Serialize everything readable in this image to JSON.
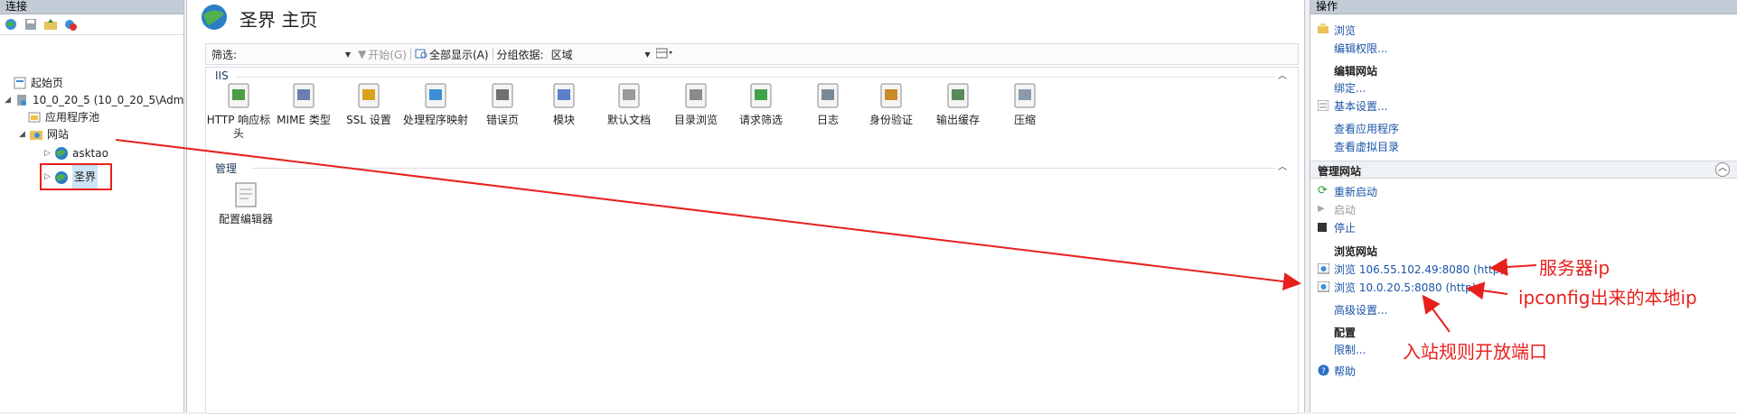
{
  "left": {
    "title": "连接",
    "tree": {
      "start_page": "起始页",
      "server": "10_0_20_5 (10_0_20_5\\Adm",
      "app_pools": "应用程序池",
      "sites": "网站",
      "site_asktao": "asktao",
      "site_shengjie": "圣界"
    }
  },
  "center": {
    "title": "圣界 主页",
    "filter": {
      "label": "筛选:",
      "go": "开始(G)",
      "show_all": "全部显示(A)",
      "group_by_label": "分组依据:",
      "group_by_value": "区域"
    },
    "groups": [
      {
        "name": "IIS",
        "features": [
          "HTTP 响应标头",
          "MIME 类型",
          "SSL 设置",
          "处理程序映射",
          "错误页",
          "模块",
          "默认文档",
          "目录浏览",
          "请求筛选",
          "日志",
          "身份验证",
          "输出缓存",
          "压缩"
        ]
      },
      {
        "name": "管理",
        "features": [
          "配置编辑器"
        ]
      }
    ]
  },
  "right": {
    "title": "操作",
    "browse": "浏览",
    "edit_permissions": "编辑权限...",
    "edit_site_header": "编辑网站",
    "bindings": "绑定...",
    "basic_settings": "基本设置...",
    "view_apps": "查看应用程序",
    "view_vdirs": "查看虚拟目录",
    "manage_site_header": "管理网站",
    "restart": "重新启动",
    "start": "启动",
    "stop": "停止",
    "browse_site_header": "浏览网站",
    "browse_public": "浏览 106.55.102.49:8080 (http)",
    "browse_local": "浏览 10.0.20.5:8080 (http)",
    "advanced_settings": "高级设置...",
    "config_header": "配置",
    "limits": "限制...",
    "help": "帮助"
  },
  "annotations": {
    "server_ip": "服务器ip",
    "local_ip": "ipconfig出来的本地ip",
    "inbound_rule": "入站规则开放端口"
  },
  "colors": {
    "annotation": "#e8201c",
    "link": "#1a55a8",
    "pane_title_bg": "#c3ccd6"
  }
}
